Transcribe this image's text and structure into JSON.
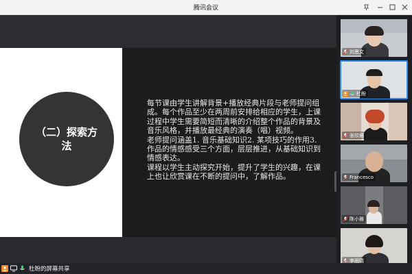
{
  "window": {
    "title": "腾讯会议",
    "controls": [
      "pin-icon",
      "minimize-icon",
      "maximize-icon",
      "close-icon"
    ]
  },
  "slide": {
    "section_title": "（二）探索方法",
    "paragraphs": [
      "每节课由学生讲解背景+播放经典片段与老师提问组成。每个作品至少在两周前安排给相应的学生，上课过程中学生需要简短而清晰的介绍整个作品的背景及音乐风格，并播放最经典的演奏（唱）视频。",
      "老师提问涵盖1. 音乐基础知识2. 某项技巧的作用3. 作品的情感感受三个方面，层层推进，从基础知识到情感表达。",
      "课程以学生主动探究开始，提升了学生的兴趣，在课上也让欣赏课在不断的提问中，了解作品。"
    ]
  },
  "bottom": {
    "share_label": "杜盼的屏幕共享"
  },
  "participants": [
    {
      "name": "刘思文",
      "active": false,
      "bg": "#c9ccd0"
    },
    {
      "name": "杜盼",
      "active": true,
      "bg": "#dfe2e4"
    },
    {
      "name": "张欣雅",
      "active": false,
      "bg": "#e6dcd4"
    },
    {
      "name": "Francesco",
      "active": false,
      "bg": "#8a8e92"
    },
    {
      "name": "陈小雅",
      "active": false,
      "bg": "#5a5c60"
    },
    {
      "name": "李雨晴",
      "active": false,
      "bg": "#d6d4d0"
    }
  ],
  "colors": {
    "accent": "#2c8cf4",
    "mic_muted": "#e64545"
  }
}
